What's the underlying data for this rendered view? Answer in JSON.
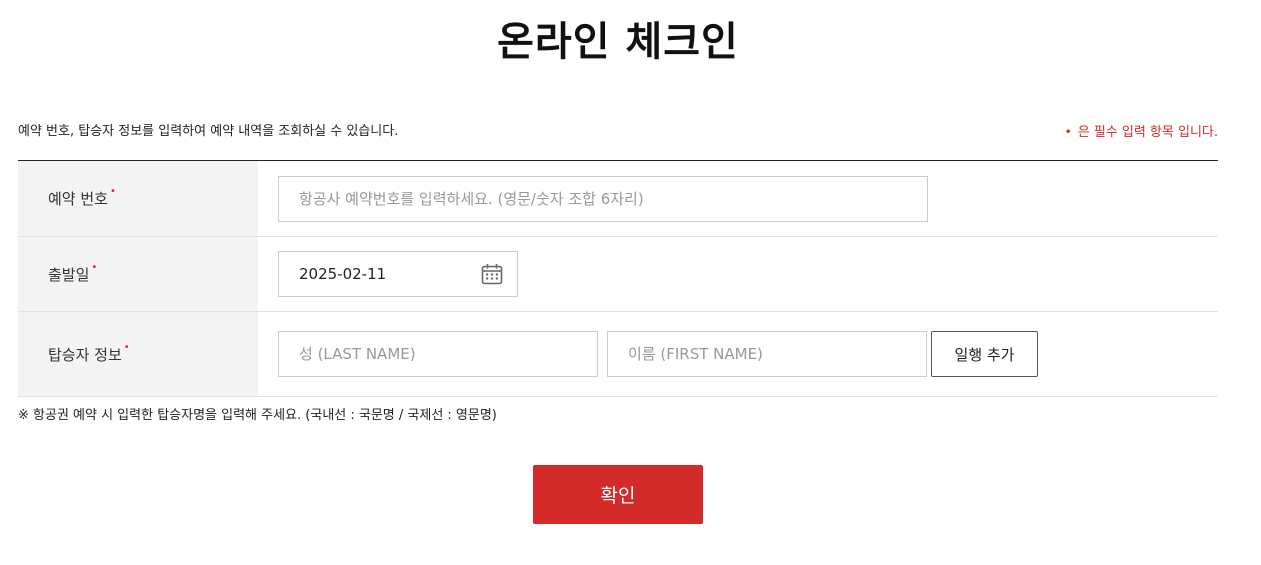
{
  "page": {
    "title": "온라인 체크인"
  },
  "intro": {
    "description": "예약 번호, 탑승자 정보를 입력하여 예약 내역을 조회하실 수 있습니다.",
    "required_marker": "•",
    "required_note": "은 필수 입력 항목 입니다."
  },
  "form": {
    "required_marker": "•",
    "reservation": {
      "label": "예약 번호",
      "value": "",
      "placeholder": "항공사 예약번호를 입력하세요. (영문/숫자 조합 6자리)"
    },
    "departure": {
      "label": "출발일",
      "value": "2025-02-11",
      "icon": "calendar-icon"
    },
    "passenger": {
      "label": "탑승자 정보",
      "last_name_value": "",
      "last_name_placeholder": "성 (LAST NAME)",
      "first_name_value": "",
      "first_name_placeholder": "이름 (FIRST NAME)",
      "add_button_label": "일행 추가"
    }
  },
  "notice": "※ 항공권 예약 시 입력한 탑승자명을 입력해 주세요. (국내선 : 국문명 / 국제선 : 영문명)",
  "confirm_button_label": "확인",
  "colors": {
    "accent": "#d32a2a",
    "label_bg": "#f4f4f4",
    "border": "#cccccc"
  }
}
